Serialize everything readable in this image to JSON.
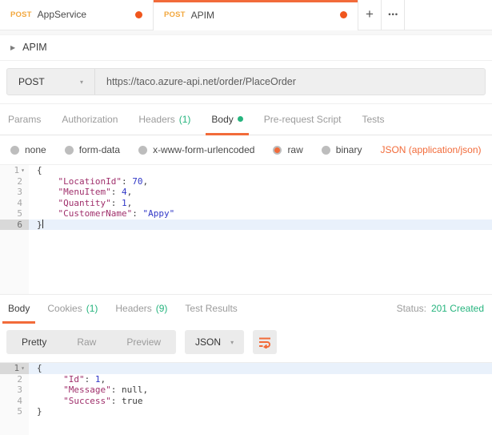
{
  "colors": {
    "accent_orange": "#F26B3A",
    "method_label_orange": "#F2A73D",
    "unsaved_dot_orange": "#F0561D",
    "green": "#26B47E",
    "json_key": "#A0306C",
    "json_value": "#3138C7"
  },
  "icons": {
    "caret_right": "▶",
    "caret_down_small": "▾",
    "dropdown_caret": "▾",
    "plus": "+",
    "more": "●●●"
  },
  "tabbar": {
    "tabs": [
      {
        "method": "POST",
        "title": "AppService"
      },
      {
        "method": "POST",
        "title": "APIM"
      }
    ]
  },
  "request": {
    "section_title": "APIM",
    "method": "POST",
    "url": "https://taco.azure-api.net/order/PlaceOrder",
    "tabs": {
      "params": "Params",
      "authorization": "Authorization",
      "headers": "Headers",
      "headers_count": "(1)",
      "body": "Body",
      "prerequest": "Pre-request Script",
      "tests": "Tests"
    },
    "body_types": {
      "none": "none",
      "form_data": "form-data",
      "urlencoded": "x-www-form-urlencoded",
      "raw": "raw",
      "binary": "binary"
    },
    "selected_body_type": "raw",
    "content_type": "JSON (application/json)"
  },
  "request_editor": {
    "lines": [
      {
        "num": "1",
        "open": "{"
      },
      {
        "num": "2",
        "key": "    \"LocationId\"",
        "colon": ": ",
        "value": "70",
        "comma": ","
      },
      {
        "num": "3",
        "key": "    \"MenuItem\"",
        "colon": ": ",
        "value": "4",
        "comma": ","
      },
      {
        "num": "4",
        "key": "    \"Quantity\"",
        "colon": ": ",
        "value": "1",
        "comma": ","
      },
      {
        "num": "5",
        "key": "    \"CustomerName\"",
        "colon": ": ",
        "value": "\"Appy\""
      },
      {
        "num": "6",
        "close": "}"
      }
    ]
  },
  "response": {
    "tabs": {
      "body": "Body",
      "cookies": "Cookies",
      "cookies_count": "(1)",
      "headers": "Headers",
      "headers_count": "(9)",
      "test_results": "Test Results"
    },
    "status_label": "Status:",
    "status_value": "201 Created",
    "view_modes": {
      "pretty": "Pretty",
      "raw": "Raw",
      "preview": "Preview"
    },
    "selected_view_mode": "Pretty",
    "format": "JSON"
  },
  "response_editor": {
    "lines": [
      {
        "num": "1",
        "open": "{"
      },
      {
        "num": "2",
        "key": "     \"Id\"",
        "colon": ": ",
        "value": "1",
        "comma": ","
      },
      {
        "num": "3",
        "key": "     \"Message\"",
        "colon": ": ",
        "plain": "null",
        "comma": ","
      },
      {
        "num": "4",
        "key": "     \"Success\"",
        "colon": ": ",
        "plain": "true"
      },
      {
        "num": "5",
        "close": "}"
      }
    ]
  }
}
